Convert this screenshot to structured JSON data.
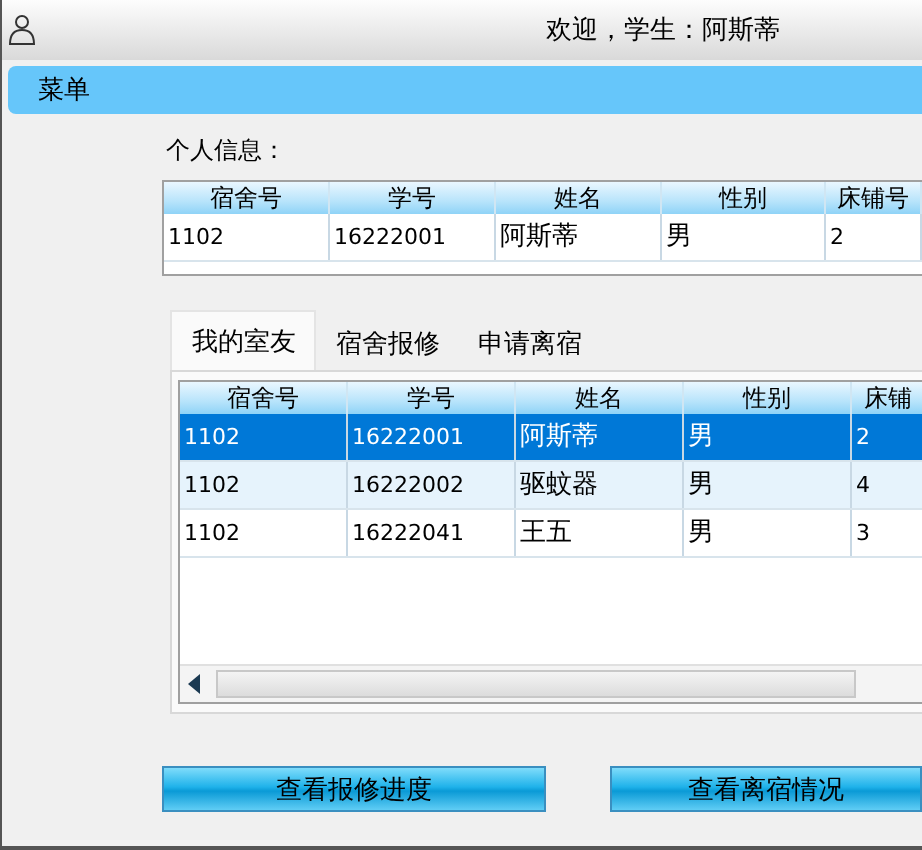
{
  "window": {
    "title": "欢迎，学生：阿斯蒂"
  },
  "menu_bar": {
    "label": "菜单"
  },
  "personal_info": {
    "label": "个人信息：",
    "columns": [
      "宿舍号",
      "学号",
      "姓名",
      "性别",
      "床铺号"
    ],
    "rows": [
      {
        "cells": [
          "1102",
          "16222001",
          "阿斯蒂",
          "男",
          "2"
        ],
        "selected": false
      }
    ]
  },
  "tabs": [
    {
      "label": "我的室友",
      "selected": true
    },
    {
      "label": "宿舍报修",
      "selected": false
    },
    {
      "label": "申请离宿",
      "selected": false
    }
  ],
  "roommates": {
    "columns": [
      "宿舍号",
      "学号",
      "姓名",
      "性别",
      "床铺"
    ],
    "rows": [
      {
        "cells": [
          "1102",
          "16222001",
          "阿斯蒂",
          "男",
          "2"
        ],
        "selected": true
      },
      {
        "cells": [
          "1102",
          "16222002",
          "驱蚊器",
          "男",
          "4"
        ],
        "selected": false
      },
      {
        "cells": [
          "1102",
          "16222041",
          "王五",
          "男",
          "3"
        ],
        "selected": false
      }
    ]
  },
  "buttons": [
    "查看报修进度",
    "查看离宿情况"
  ]
}
